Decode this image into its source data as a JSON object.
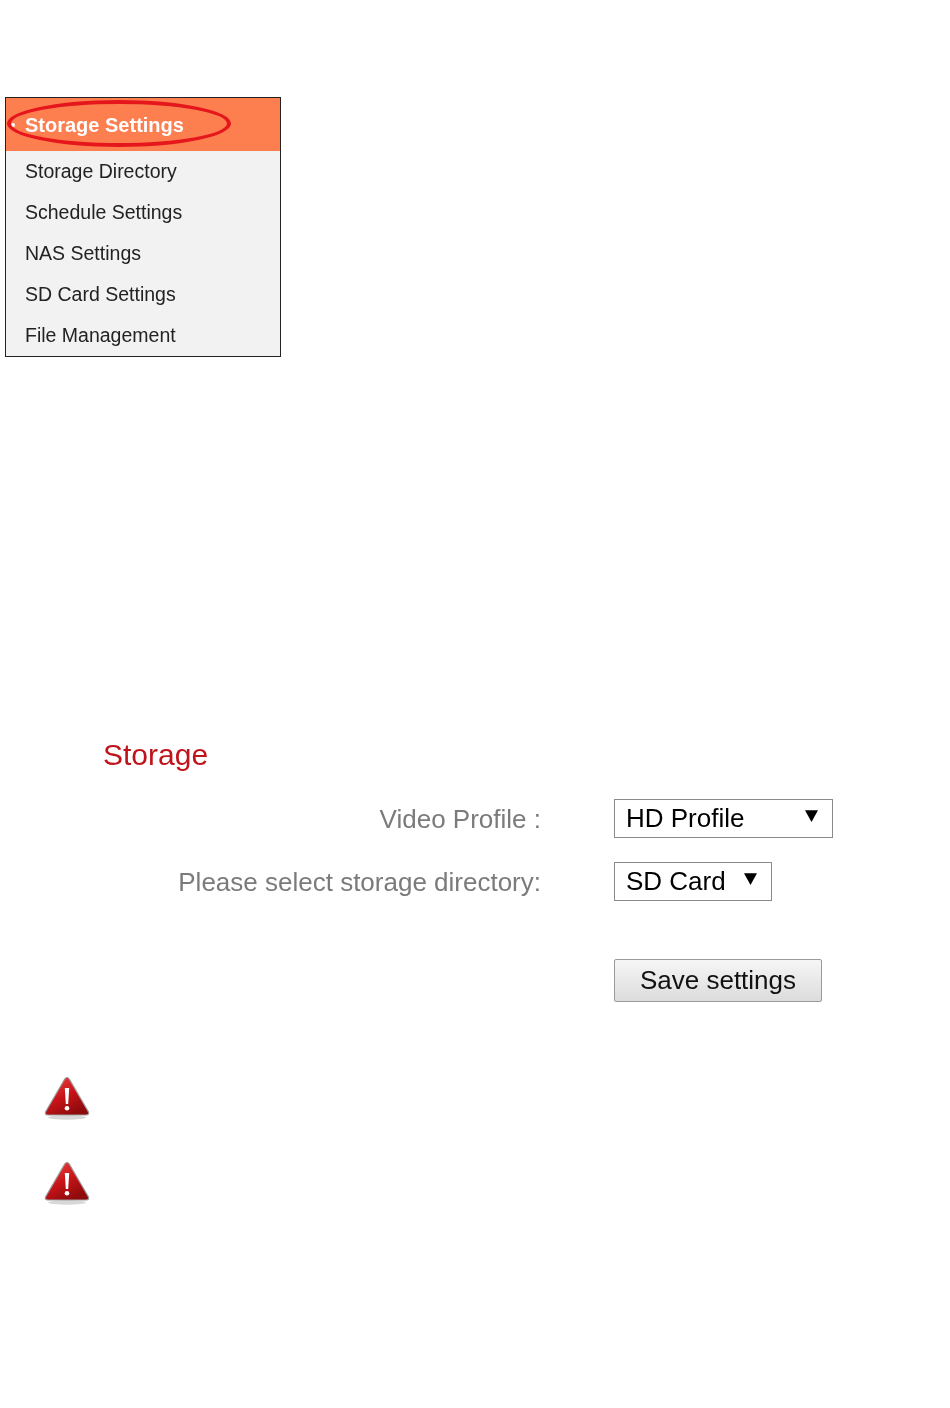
{
  "sidebar": {
    "header": {
      "label": "Storage Settings",
      "circled": true
    },
    "items": [
      {
        "label": "Storage Directory"
      },
      {
        "label": "Schedule Settings"
      },
      {
        "label": "NAS Settings"
      },
      {
        "label": "SD Card Settings"
      },
      {
        "label": "File Management"
      }
    ]
  },
  "panel": {
    "title": "Storage",
    "fields": [
      {
        "label": "Video Profile :",
        "value": "HD Profile"
      },
      {
        "label": "Please select storage directory:",
        "value": "SD Card"
      }
    ],
    "save_button": "Save settings"
  },
  "warnings": [
    {
      "kind": "warning"
    },
    {
      "kind": "warning"
    }
  ]
}
